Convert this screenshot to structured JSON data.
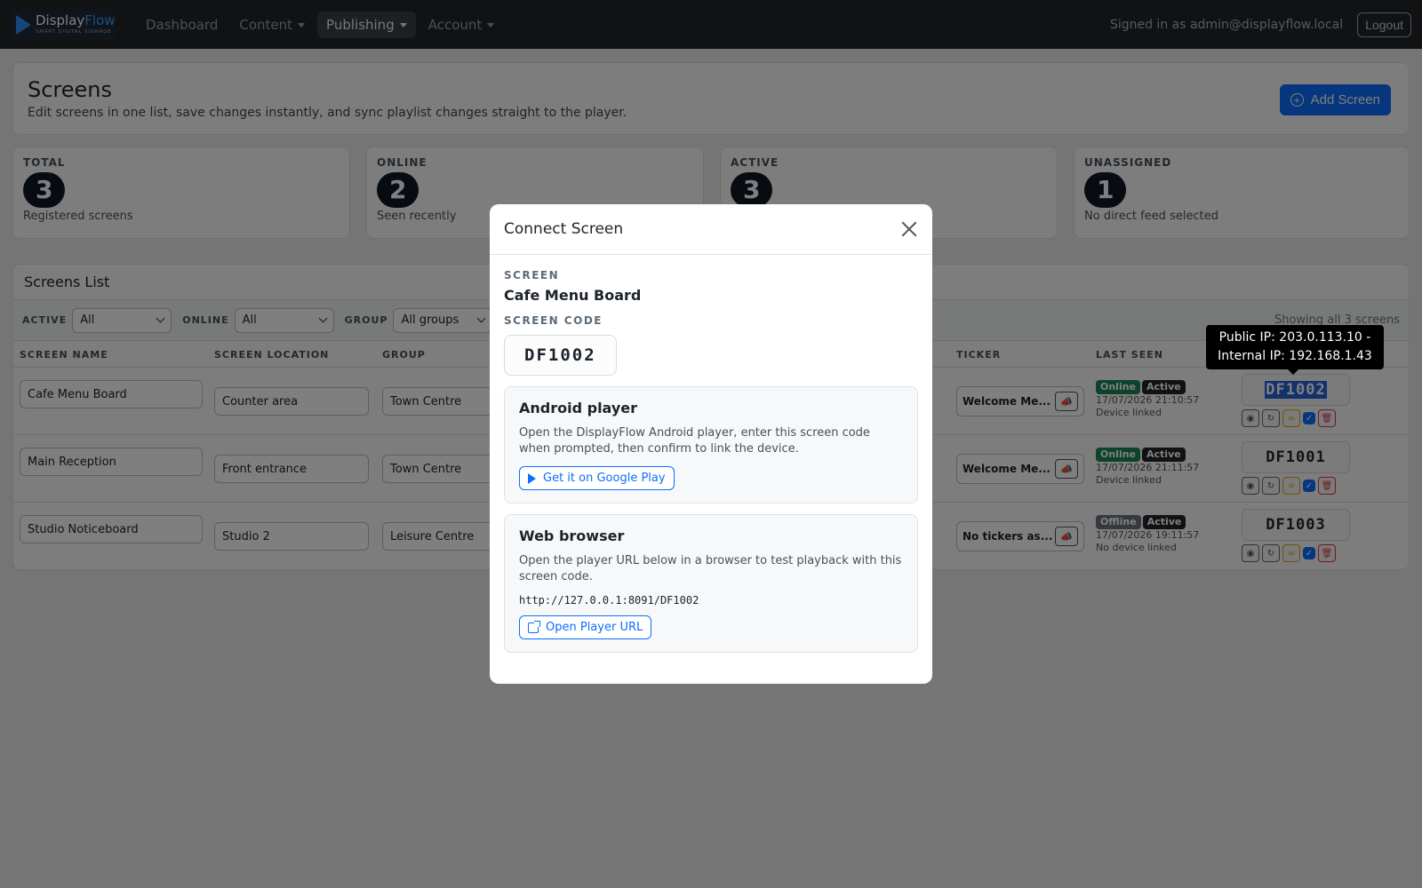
{
  "nav": {
    "logo": {
      "name_a": "Display",
      "name_b": "Flow",
      "tagline": "SMART DIGITAL SIGNAGE"
    },
    "links": [
      {
        "label": "Dashboard",
        "dropdown": false,
        "active": false
      },
      {
        "label": "Content",
        "dropdown": true,
        "active": false
      },
      {
        "label": "Publishing",
        "dropdown": true,
        "active": true
      },
      {
        "label": "Account",
        "dropdown": true,
        "active": false
      }
    ],
    "signed_in": "Signed in as admin@displayflow.local",
    "logout": "Logout"
  },
  "header": {
    "title": "Screens",
    "subtitle": "Edit screens in one list, save changes instantly, and sync playlist changes straight to the player.",
    "add_button": "Add Screen"
  },
  "stats": [
    {
      "label": "TOTAL",
      "value": "3",
      "desc": "Registered screens"
    },
    {
      "label": "ONLINE",
      "value": "2",
      "desc": "Seen recently"
    },
    {
      "label": "ACTIVE",
      "value": "3",
      "desc": ""
    },
    {
      "label": "UNASSIGNED",
      "value": "1",
      "desc": "No direct feed selected"
    }
  ],
  "list": {
    "title": "Screens List",
    "filters": [
      {
        "label": "ACTIVE",
        "value": "All"
      },
      {
        "label": "ONLINE",
        "value": "All"
      },
      {
        "label": "GROUP",
        "value": "All groups"
      }
    ],
    "showing": "Showing all 3 screens",
    "columns": {
      "name": "SCREEN NAME",
      "location": "SCREEN LOCATION",
      "group": "GROUP",
      "ticker": "TICKER",
      "last_seen": "LAST SEEN"
    },
    "rows": [
      {
        "name": "Cafe Menu Board",
        "location": "Counter area",
        "group": "Town Centre",
        "ticker": "Welcome Me...",
        "status": "Online",
        "active": "Active",
        "seen": "17/07/2026 21:10:57",
        "device": "Device linked",
        "code": "DF1002"
      },
      {
        "name": "Main Reception",
        "location": "Front entrance",
        "group": "Town Centre",
        "ticker": "Welcome Me...",
        "status": "Online",
        "active": "Active",
        "seen": "17/07/2026 21:11:57",
        "device": "Device linked",
        "code": "DF1001"
      },
      {
        "name": "Studio Noticeboard",
        "location": "Studio 2",
        "group": "Leisure Centre",
        "ticker": "No tickers as...",
        "status": "Offline",
        "active": "Active",
        "seen": "17/07/2026 19:11:57",
        "device": "No device linked",
        "code": "DF1003"
      }
    ]
  },
  "tooltip": {
    "line1": "Public IP: 203.0.113.10 -",
    "line2": "Internal IP: 192.168.1.43"
  },
  "modal": {
    "title": "Connect Screen",
    "screen_label": "SCREEN",
    "screen_name": "Cafe Menu Board",
    "code_label": "SCREEN CODE",
    "code": "DF1002",
    "android": {
      "title": "Android player",
      "text": "Open the DisplayFlow Android player, enter this screen code when prompted, then confirm to link the device.",
      "button": "Get it on Google Play"
    },
    "web": {
      "title": "Web browser",
      "text": "Open the player URL below in a browser to test playback with this screen code.",
      "url": "http://127.0.0.1:8091/DF1002",
      "button": "Open Player URL"
    }
  },
  "colors": {
    "primary": "#0d6efd",
    "navbar": "#212529",
    "online": "#198754",
    "offline": "#6c757d"
  }
}
